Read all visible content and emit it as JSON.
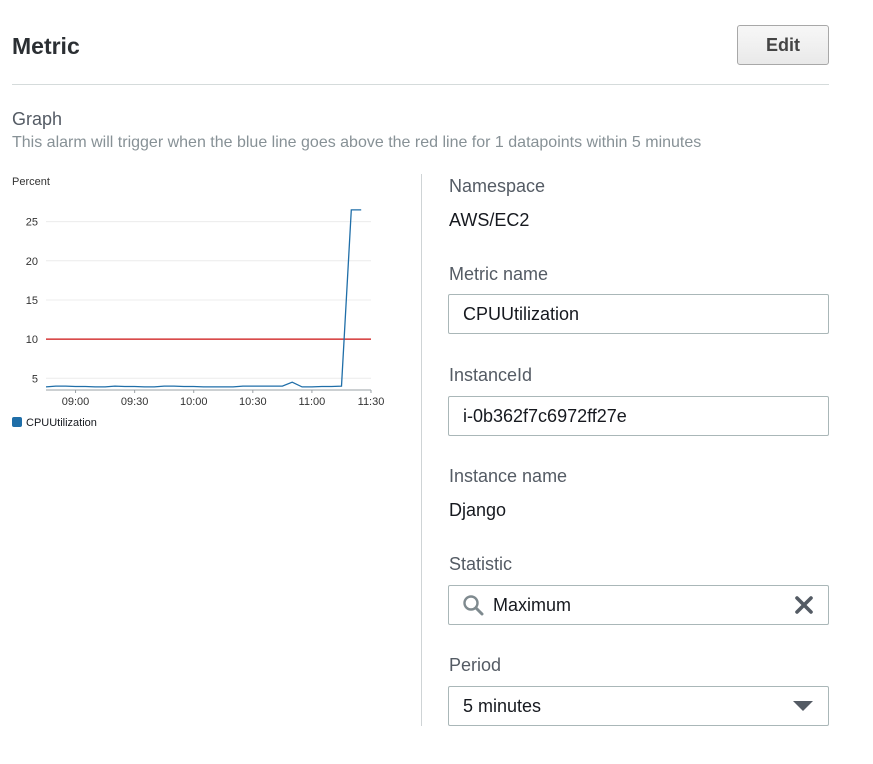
{
  "header": {
    "title": "Metric",
    "edit_label": "Edit"
  },
  "graph": {
    "title": "Graph",
    "description": "This alarm will trigger when the blue line goes above the red line for 1 datapoints within 5 minutes"
  },
  "chart_data": {
    "type": "line",
    "title": "",
    "ylabel": "Percent",
    "xlabel": "",
    "x_ticks": [
      "09:00",
      "09:30",
      "10:00",
      "10:30",
      "11:00",
      "11:30"
    ],
    "y_ticks": [
      5,
      10,
      15,
      20,
      25
    ],
    "ylim": [
      3.5,
      27
    ],
    "xlim_minutes": [
      525,
      690
    ],
    "grid": true,
    "legend_position": "bottom-left",
    "threshold": {
      "value": 10,
      "color": "#cc1111"
    },
    "series": [
      {
        "name": "CPUUtilization",
        "color": "#1f6ea8",
        "x": [
          "08:45",
          "08:50",
          "08:55",
          "09:00",
          "09:05",
          "09:10",
          "09:15",
          "09:20",
          "09:25",
          "09:30",
          "09:35",
          "09:40",
          "09:45",
          "09:50",
          "09:55",
          "10:00",
          "10:05",
          "10:10",
          "10:15",
          "10:20",
          "10:25",
          "10:30",
          "10:35",
          "10:40",
          "10:45",
          "10:50",
          "10:55",
          "11:00",
          "11:05",
          "11:10",
          "11:15",
          "11:20",
          "11:25"
        ],
        "values": [
          3.9,
          4.0,
          4.0,
          3.95,
          3.95,
          3.9,
          3.9,
          4.0,
          3.95,
          3.95,
          3.9,
          3.9,
          4.0,
          4.0,
          3.95,
          3.95,
          3.9,
          3.9,
          3.9,
          3.9,
          4.0,
          4.0,
          4.0,
          4.0,
          4.0,
          4.5,
          3.9,
          3.9,
          3.95,
          3.95,
          4.0,
          26.5,
          26.5
        ]
      }
    ]
  },
  "fields": {
    "namespace": {
      "label": "Namespace",
      "value": "AWS/EC2"
    },
    "metric_name": {
      "label": "Metric name",
      "value": "CPUUtilization"
    },
    "instance_id": {
      "label": "InstanceId",
      "value": "i-0b362f7c6972ff27e"
    },
    "instance_name": {
      "label": "Instance name",
      "value": "Django"
    },
    "statistic": {
      "label": "Statistic",
      "value": "Maximum"
    },
    "period": {
      "label": "Period",
      "value": "5 minutes"
    }
  },
  "icons": {
    "search": "search-icon",
    "clear": "close-icon",
    "dropdown": "caret-down-icon"
  }
}
